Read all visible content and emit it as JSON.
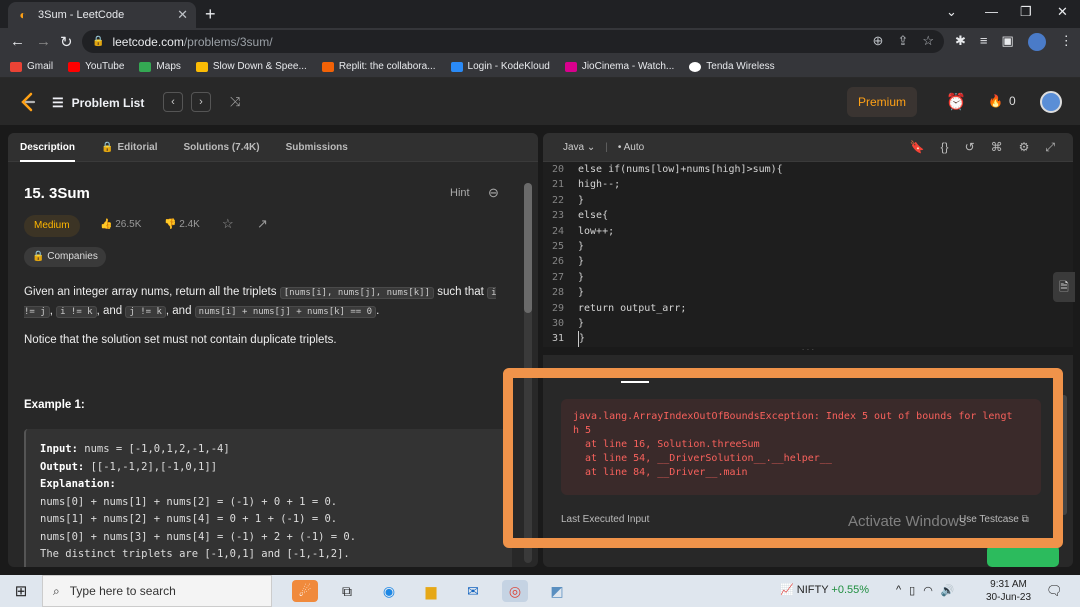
{
  "browser": {
    "tab_title": "3Sum - LeetCode",
    "tab_close": "✕",
    "new_tab": "+",
    "url_host": "leetcode.com",
    "url_path": "/problems/3sum/",
    "bookmarks": [
      {
        "label": "Gmail",
        "color": "#ea4335"
      },
      {
        "label": "YouTube",
        "color": "#ff0000"
      },
      {
        "label": "Maps",
        "color": "#34a853"
      },
      {
        "label": "Slow Down & Spee...",
        "color": "#fbbc05"
      },
      {
        "label": "Replit: the collabora...",
        "color": "#f26207"
      },
      {
        "label": "Login - KodeKloud",
        "color": "#2a8af6"
      },
      {
        "label": "JioCinema - Watch...",
        "color": "#d9008d"
      },
      {
        "label": "Tenda Wireless",
        "color": "#ffffff"
      }
    ]
  },
  "leetcode": {
    "problem_list": "Problem List",
    "premium": "Premium",
    "streak": "0",
    "tabs": [
      "Description",
      "Editorial",
      "Solutions (7.4K)",
      "Submissions"
    ],
    "title": "15. 3Sum",
    "hint": "Hint",
    "difficulty": "Medium",
    "likes": "26.5K",
    "dislikes": "2.4K",
    "companies": "Companies",
    "desc_p1_a": "Given an integer array nums, return all the triplets ",
    "desc_code1": "[nums[i], nums[j], nums[k]]",
    "desc_p1_b": " such that ",
    "desc_code2": "i != j",
    "desc_code3": "i != k",
    "desc_and": ", and ",
    "desc_code4": "j != k",
    "desc_code5": "nums[i] + nums[j] + nums[k] == 0",
    "notice": "Notice that the solution set must not contain duplicate triplets.",
    "example_head": "Example 1:",
    "example": {
      "input_label": "Input:",
      "input": " nums = [-1,0,1,2,-1,-4]",
      "output_label": "Output:",
      "output": " [[-1,-1,2],[-1,0,1]]",
      "expl_label": "Explanation:",
      "lines": [
        "nums[0] + nums[1] + nums[2] = (-1) + 0 + 1 = 0.",
        "nums[1] + nums[2] + nums[4] = 0 + 1 + (-1) = 0.",
        "nums[0] + nums[3] + nums[4] = (-1) + 2 + (-1) = 0.",
        "The distinct triplets are [-1,0,1] and [-1,-1,2]."
      ]
    }
  },
  "editor": {
    "language": "Java",
    "mode": "Auto",
    "lines": [
      {
        "n": "20",
        "t": "else if(nums[low]+nums[high]>sum){"
      },
      {
        "n": "21",
        "t": "high--;"
      },
      {
        "n": "22",
        "t": "}"
      },
      {
        "n": "23",
        "t": "else{"
      },
      {
        "n": "24",
        "t": "low++;"
      },
      {
        "n": "25",
        "t": "}"
      },
      {
        "n": "26",
        "t": "}"
      },
      {
        "n": "27",
        "t": "}"
      },
      {
        "n": "28",
        "t": "}"
      },
      {
        "n": "29",
        "t": "return output_arr;"
      },
      {
        "n": "30",
        "t": "}"
      },
      {
        "n": "31",
        "t": "}"
      }
    ]
  },
  "console": {
    "error_line1": "java.lang.ArrayIndexOutOfBoundsException: Index 5 out of bounds for lengt",
    "error_line2": "h 5",
    "stack": [
      "at line 16, Solution.threeSum",
      "at line 54, __DriverSolution__.__helper__",
      "at line 84, __Driver__.main"
    ],
    "last_input": "Last Executed Input",
    "use_testcase": "Use Testcase"
  },
  "watermark": "Activate Windows",
  "taskbar": {
    "search_placeholder": "Type here to search",
    "nifty_label": "NIFTY",
    "nifty_value": "+0.55%",
    "time": "9:31 AM",
    "date": "30-Jun-23"
  }
}
